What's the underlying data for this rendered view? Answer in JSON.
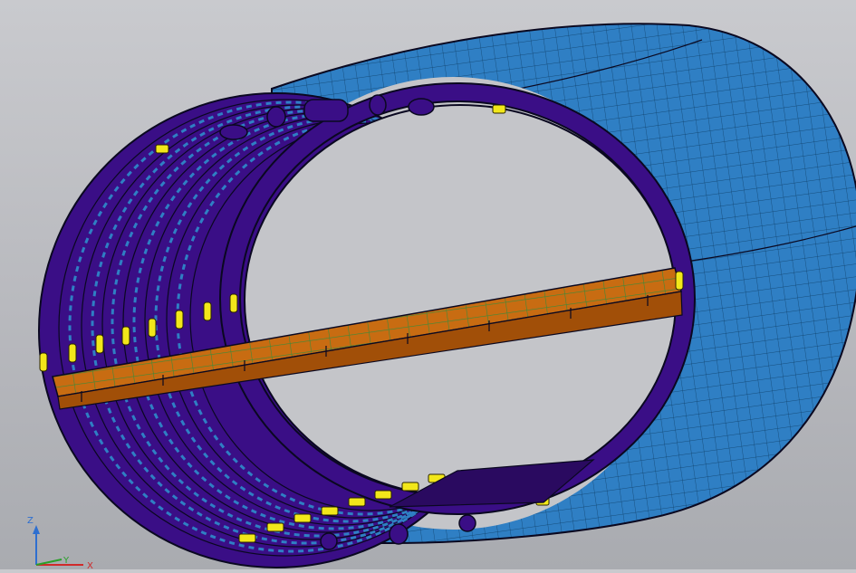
{
  "view": {
    "model": "fuselage-barrel-section",
    "colors": {
      "background_top": "#c9cace",
      "background_bottom": "#a9abb0",
      "skin": "#2f7fc4",
      "skin_grid": "#0d3d66",
      "frame": "#3a0e86",
      "frame_edge": "#0a0820",
      "floor_top": "#c86c12",
      "floor_side": "#a14f08",
      "floor_grid": "#3d8a3a",
      "clip": "#f2e71a"
    },
    "frame_count": 8
  },
  "triad": {
    "z_label": "Z",
    "x_label": "X",
    "y_label": "Y",
    "z_color": "#2e6fd0",
    "x_color": "#d02a2a",
    "y_color": "#2aa02a"
  }
}
